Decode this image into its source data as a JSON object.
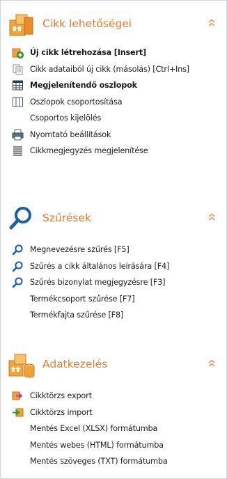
{
  "sections": [
    {
      "title": "Cikk lehetőségei",
      "icon": "boxes-add-icon",
      "collapse_icon": "double-chevron-up-icon",
      "items": [
        {
          "label": "Új cikk létrehozása [Insert]",
          "icon": "new-item-icon",
          "bold": true
        },
        {
          "label": "Cikk adataiból új cikk (másolás) [Ctrl+Ins]",
          "icon": "copy-document-icon",
          "bold": false
        },
        {
          "label": "Megjelenítendő oszlopok",
          "icon": "columns-grid-icon",
          "bold": true
        },
        {
          "label": "Oszlopok csoportosítása",
          "icon": "column-group-icon",
          "bold": false
        },
        {
          "label": "Csoportos kijelölés",
          "icon": "",
          "bold": false
        },
        {
          "label": "Nyomtató beállítások",
          "icon": "printer-icon",
          "bold": false
        },
        {
          "label": "Cikkmegjegyzés megjelenítése",
          "icon": "text-lines-icon",
          "bold": false
        }
      ]
    },
    {
      "title": "Szűrések",
      "icon": "magnifier-icon",
      "collapse_icon": "double-chevron-up-icon",
      "items": [
        {
          "label": "Megnevezésre szűrés [F5]",
          "icon": "search-icon",
          "bold": false
        },
        {
          "label": "Szűrés a cikk általános leírására [F4]",
          "icon": "search-icon",
          "bold": false
        },
        {
          "label": "Szűrés bizonylat megjegyzésre [F3]",
          "icon": "search-icon",
          "bold": false
        },
        {
          "label": "Termékcsoport szűrése [F7]",
          "icon": "",
          "bold": false
        },
        {
          "label": "Termékfajta szűrése [F8]",
          "icon": "",
          "bold": false
        }
      ]
    },
    {
      "title": "Adatkezelés",
      "icon": "boxes-database-icon",
      "collapse_icon": "double-chevron-up-icon",
      "items": [
        {
          "label": "Cikktörzs export",
          "icon": "export-arrow-icon",
          "bold": false
        },
        {
          "label": "Cikktörzs import",
          "icon": "import-arrow-icon",
          "bold": false
        },
        {
          "label": "Mentés Excel (XLSX) formátumba",
          "icon": "",
          "bold": false
        },
        {
          "label": "Mentés webes (HTML) formátumba",
          "icon": "",
          "bold": false
        },
        {
          "label": "Mentés szöveges (TXT) formátumba",
          "icon": "",
          "bold": false
        }
      ]
    }
  ],
  "colors": {
    "section_title": "#e8792c",
    "search_blue": "#1f5fa8",
    "box_orange": "#f0a23a",
    "collapse": "#d98b4a"
  }
}
